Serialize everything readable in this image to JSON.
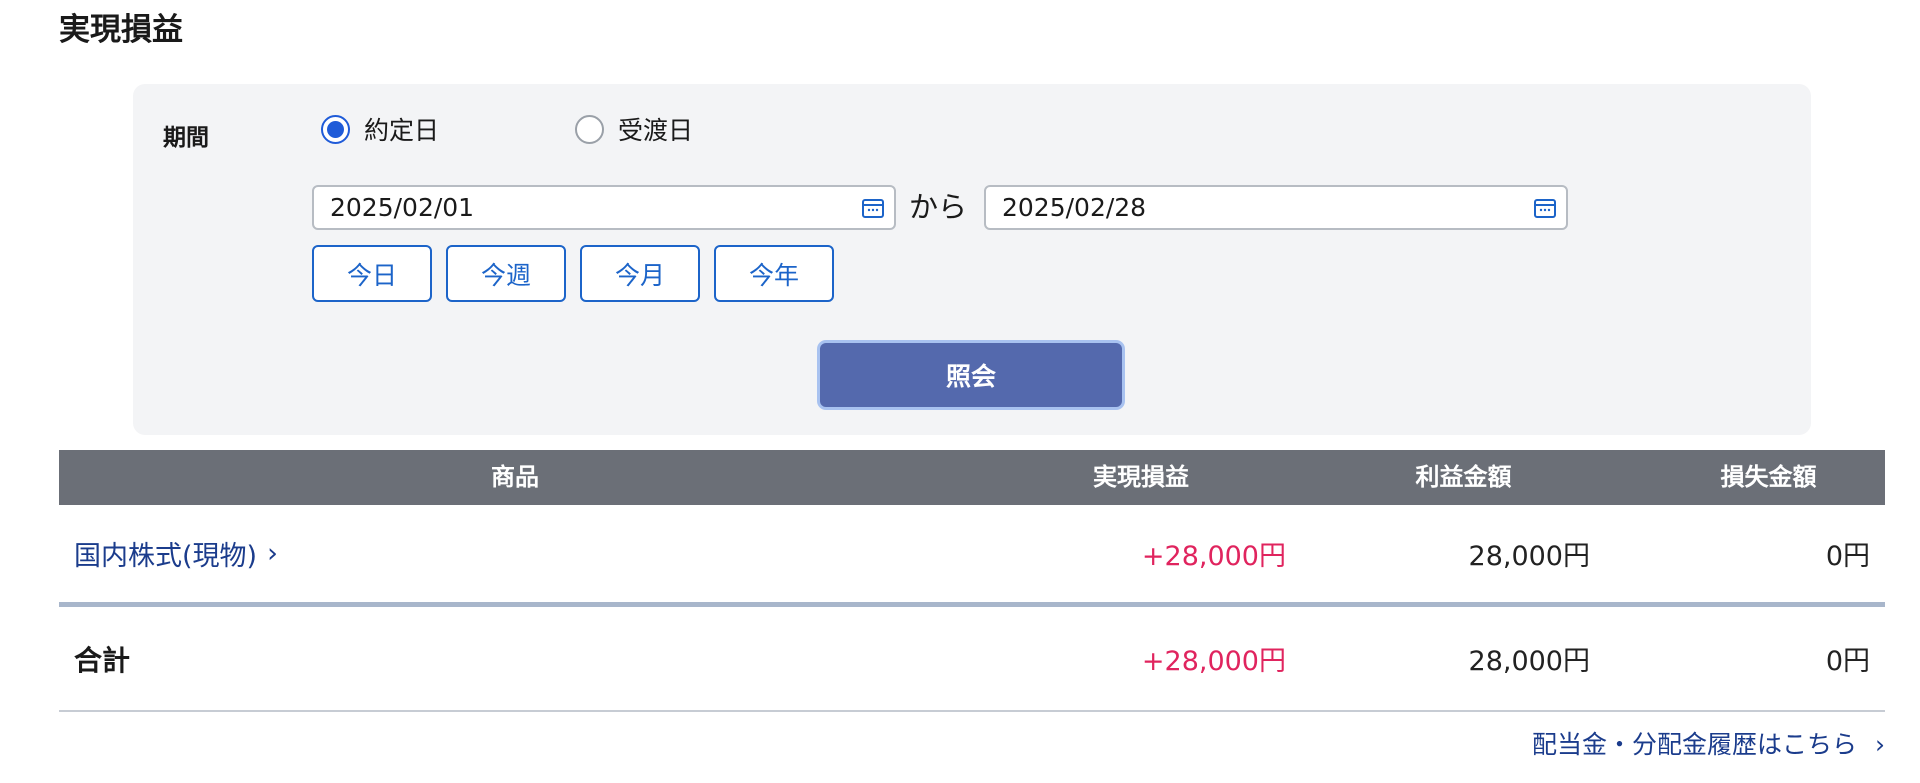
{
  "page": {
    "title": "実現損益"
  },
  "filter": {
    "period_label": "期間",
    "radios": [
      {
        "label": "約定日",
        "checked": true
      },
      {
        "label": "受渡日",
        "checked": false
      }
    ],
    "date_from": "2025/02/01",
    "from_connector": "から",
    "date_to": "2025/02/28",
    "quick_buttons": [
      "今日",
      "今週",
      "今月",
      "今年"
    ],
    "search_label": "照会"
  },
  "table": {
    "headers": [
      "商品",
      "実現損益",
      "利益金額",
      "損失金額"
    ],
    "rows": [
      {
        "product": "国内株式(現物)",
        "chevron": "›",
        "realized": "+28,000円",
        "profit": "28,000円",
        "loss": "0円"
      }
    ],
    "total": {
      "label": "合計",
      "realized": "+28,000円",
      "profit": "28,000円",
      "loss": "0円"
    }
  },
  "footer_link": "配当金・分配金履歴はこちら",
  "footer_chevron": "›",
  "colors": {
    "accent": "#1c64c9",
    "gain": "#e0245e",
    "primary_button": "#5469ad",
    "header_bg": "#6b6f77"
  }
}
